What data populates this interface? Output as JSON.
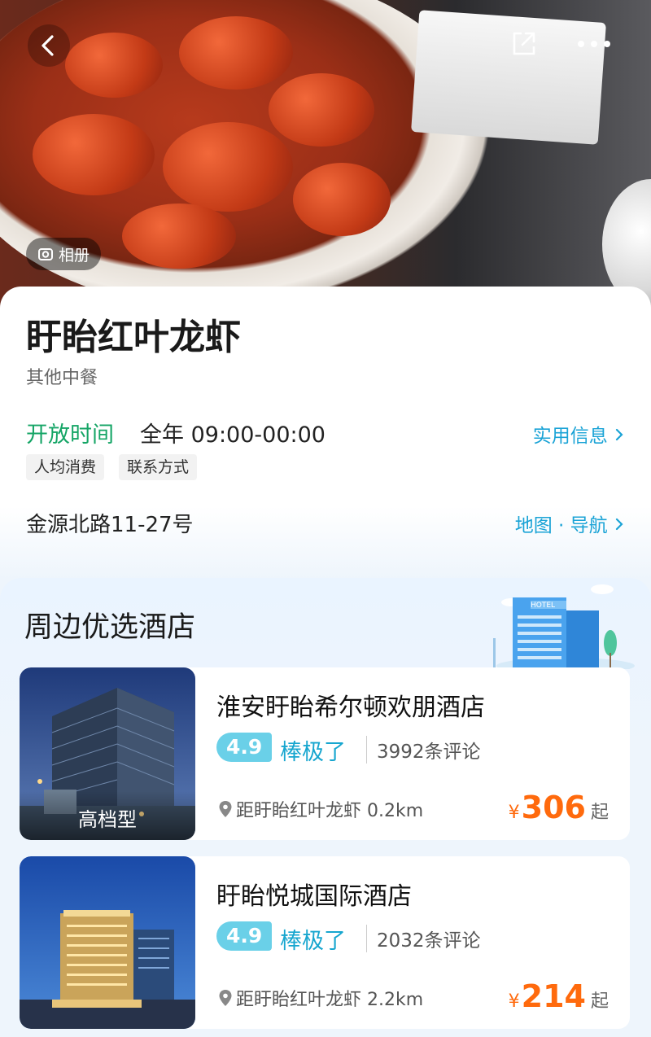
{
  "header": {
    "album_label": "相册"
  },
  "restaurant": {
    "name": "盱眙红叶龙虾",
    "category": "其他中餐",
    "hours_label": "开放时间",
    "hours_value": "全年 09:00-00:00",
    "practical_info_link": "实用信息",
    "tags": [
      "人均消费",
      "联系方式"
    ],
    "address": "金源北路11-27号",
    "map_link": "地图 · 导航"
  },
  "hotels_section": {
    "title": "周边优选酒店",
    "hotels": [
      {
        "name": "淮安盱眙希尔顿欢朋酒店",
        "grade": "高档型",
        "score": "4.9",
        "rating_word": "棒极了",
        "reviews": "3992条评论",
        "distance": "距盱眙红叶龙虾 0.2km",
        "price_symbol": "¥",
        "price": "306",
        "price_suffix": "起"
      },
      {
        "name": "盱眙悦城国际酒店",
        "grade": "",
        "score": "4.9",
        "rating_word": "棒极了",
        "reviews": "2032条评论",
        "distance": "距盱眙红叶龙虾 2.2km",
        "price_symbol": "¥",
        "price": "214",
        "price_suffix": "起"
      }
    ]
  },
  "colors": {
    "green_accent": "#15a566",
    "blue_link": "#1aa3d6",
    "price_orange": "#ff6a0d",
    "score_badge": "#6ad0e8"
  },
  "icons": [
    "back-icon",
    "share-icon",
    "more-icon",
    "camera-icon",
    "chevron-right-icon",
    "location-pin-icon"
  ]
}
